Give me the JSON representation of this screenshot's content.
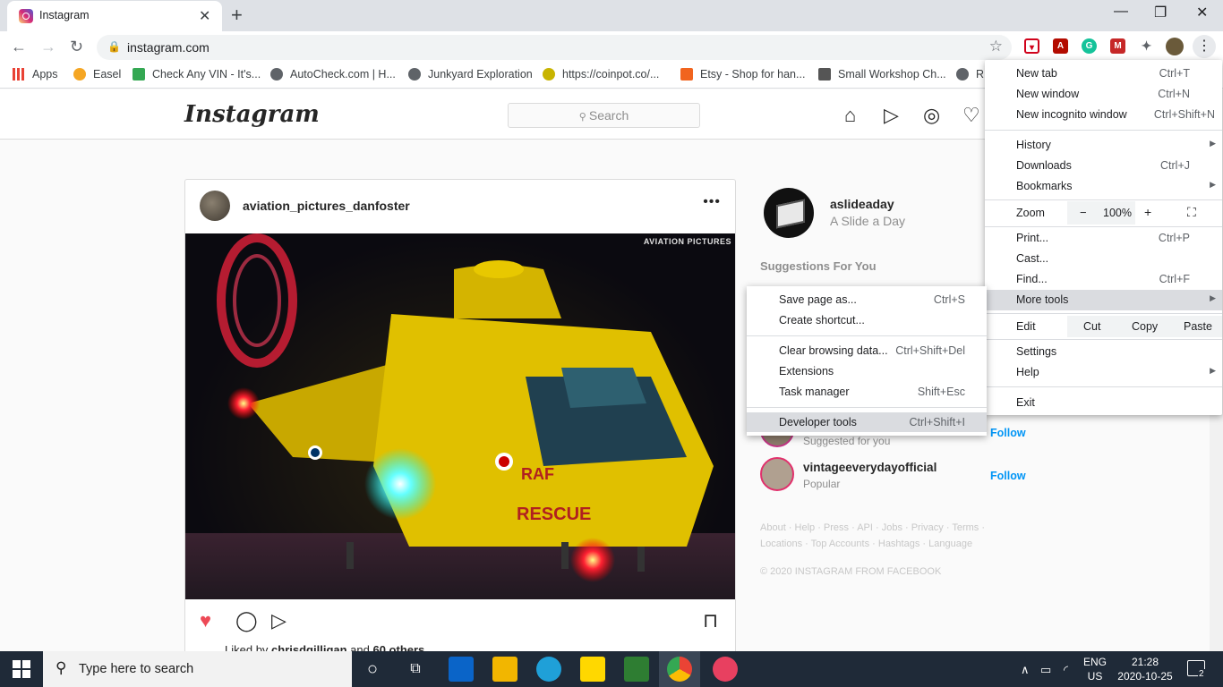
{
  "browser": {
    "tab_title": "Instagram",
    "tab_close": "✕",
    "new_tab": "+",
    "url": "instagram.com",
    "window_controls": [
      "—",
      "❐",
      "✕"
    ]
  },
  "bookmarks": [
    {
      "label": "Apps",
      "icon": "apps-grid-icon",
      "color": "#e94235"
    },
    {
      "label": "Easel",
      "icon": "easel-icon",
      "color": "#f5a623"
    },
    {
      "label": "Check Any VIN - It's...",
      "icon": "vin-icon",
      "color": "#34a853"
    },
    {
      "label": "AutoCheck.com | H...",
      "icon": "globe-icon",
      "color": "#5f6368"
    },
    {
      "label": "Junkyard Exploration",
      "icon": "globe-icon",
      "color": "#5f6368"
    },
    {
      "label": "https://coinpot.co/...",
      "icon": "coinpot-icon",
      "color": "#c8b400"
    },
    {
      "label": "Etsy - Shop for han...",
      "icon": "etsy-icon",
      "color": "#f1641e"
    },
    {
      "label": "Small Workshop Ch...",
      "icon": "workshop-icon",
      "color": "#555555"
    },
    {
      "label": "R",
      "icon": "globe-icon",
      "color": "#5f6368"
    }
  ],
  "instagram": {
    "logo": "Instagram",
    "search_placeholder": "Search",
    "post": {
      "username": "aviation_pictures_danfoster",
      "more": "•••",
      "watermark": "AVIATION PICTURES",
      "liked_by_prefix": "Liked by ",
      "liked_by_user": "chrisdgilligan",
      "liked_by_suffix": " and ",
      "liked_by_count": "60 others"
    },
    "me": {
      "username": "aslideaday",
      "name": "A Slide a Day"
    },
    "suggestions_title": "Suggestions For You",
    "suggestions": [
      {
        "sub": "Suggested for you",
        "follow": "Follow"
      },
      {
        "username": "vintageeverydayofficial",
        "sub": "Popular",
        "follow": "Follow"
      }
    ],
    "footer_links": "About · Help · Press · API · Jobs · Privacy · Terms · Locations · Top Accounts · Hashtags · Language",
    "copyright": "© 2020 INSTAGRAM FROM FACEBOOK"
  },
  "chrome_menu": {
    "new_tab": {
      "label": "New tab",
      "shortcut": "Ctrl+T"
    },
    "new_window": {
      "label": "New window",
      "shortcut": "Ctrl+N"
    },
    "incognito": {
      "label": "New incognito window",
      "shortcut": "Ctrl+Shift+N"
    },
    "history": {
      "label": "History"
    },
    "downloads": {
      "label": "Downloads",
      "shortcut": "Ctrl+J"
    },
    "bookmarks": {
      "label": "Bookmarks"
    },
    "zoom": {
      "label": "Zoom",
      "minus": "−",
      "value": "100%",
      "plus": "+"
    },
    "print": {
      "label": "Print...",
      "shortcut": "Ctrl+P"
    },
    "cast": {
      "label": "Cast..."
    },
    "find": {
      "label": "Find...",
      "shortcut": "Ctrl+F"
    },
    "more_tools": {
      "label": "More tools"
    },
    "edit": {
      "label": "Edit",
      "cut": "Cut",
      "copy": "Copy",
      "paste": "Paste"
    },
    "settings": {
      "label": "Settings"
    },
    "help": {
      "label": "Help"
    },
    "exit": {
      "label": "Exit"
    }
  },
  "more_tools_menu": {
    "save_page": {
      "label": "Save page as...",
      "shortcut": "Ctrl+S"
    },
    "create_shortcut": {
      "label": "Create shortcut..."
    },
    "clear_browsing": {
      "label": "Clear browsing data...",
      "shortcut": "Ctrl+Shift+Del"
    },
    "extensions": {
      "label": "Extensions"
    },
    "task_manager": {
      "label": "Task manager",
      "shortcut": "Shift+Esc"
    },
    "developer_tools": {
      "label": "Developer tools",
      "shortcut": "Ctrl+Shift+I"
    }
  },
  "taskbar": {
    "search_placeholder": "Type here to search",
    "lang_top": "ENG",
    "lang_bottom": "US",
    "time": "21:28",
    "date": "2020-10-25",
    "notifications": "2"
  },
  "colors": {
    "instagram_blue": "#0095f6",
    "like_red": "#ed4956",
    "menu_highlight": "#dadce0",
    "taskbar": "#1f2a38"
  }
}
